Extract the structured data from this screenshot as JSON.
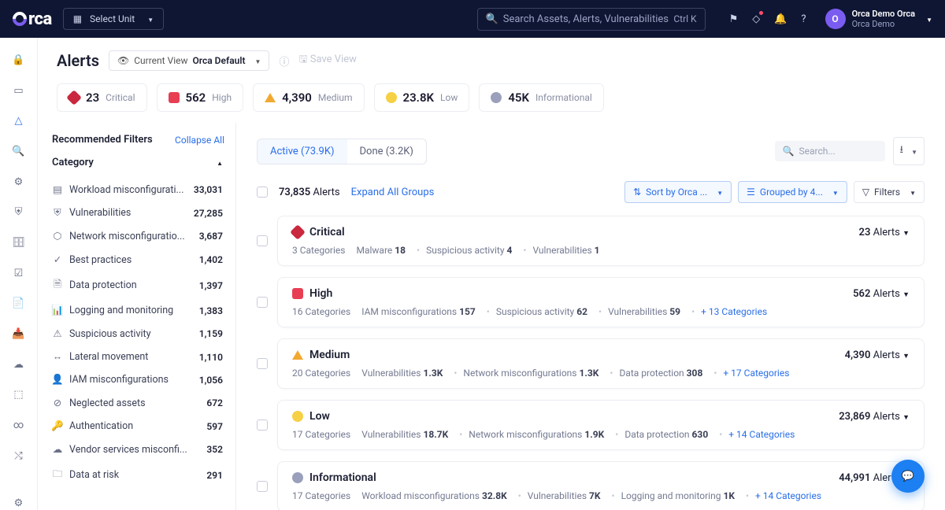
{
  "topbar": {
    "unit_label": "Select Unit",
    "search_placeholder": "Search Assets, Alerts, Vulnerabilities",
    "shortcut": "Ctrl K",
    "user_line1": "Orca Demo Orca",
    "user_line2": "Orca Demo",
    "avatar_letter": "O"
  },
  "page": {
    "title": "Alerts",
    "view_prefix": "Current View",
    "view_name": "Orca Default",
    "save_view": "Save View"
  },
  "severity_summary": [
    {
      "key": "critical",
      "count": "23",
      "label": "Critical"
    },
    {
      "key": "high",
      "count": "562",
      "label": "High"
    },
    {
      "key": "medium",
      "count": "4,390",
      "label": "Medium"
    },
    {
      "key": "low",
      "count": "23.8K",
      "label": "Low"
    },
    {
      "key": "info",
      "count": "45K",
      "label": "Informational"
    }
  ],
  "filters_panel": {
    "title": "Recommended Filters",
    "collapse": "Collapse All",
    "group": "Category",
    "items": [
      {
        "label": "Workload misconfigurati...",
        "count": "33,031"
      },
      {
        "label": "Vulnerabilities",
        "count": "27,285"
      },
      {
        "label": "Network misconfiguratio...",
        "count": "3,687"
      },
      {
        "label": "Best practices",
        "count": "1,402"
      },
      {
        "label": "Data protection",
        "count": "1,397"
      },
      {
        "label": "Logging and monitoring",
        "count": "1,383"
      },
      {
        "label": "Suspicious activity",
        "count": "1,159"
      },
      {
        "label": "Lateral movement",
        "count": "1,110"
      },
      {
        "label": "IAM misconfigurations",
        "count": "1,056"
      },
      {
        "label": "Neglected assets",
        "count": "672"
      },
      {
        "label": "Authentication",
        "count": "597"
      },
      {
        "label": "Vendor services misconfi...",
        "count": "352"
      },
      {
        "label": "Data at risk",
        "count": "291"
      }
    ]
  },
  "tabs": {
    "active": "Active (73.9K)",
    "done": "Done (3.2K)"
  },
  "results": {
    "search_placeholder": "Search...",
    "total_count": "73,835",
    "total_label": "Alerts",
    "expand_all": "Expand All Groups",
    "sort_label": "Sort by Orca ...",
    "group_label": "Grouped by 4...",
    "filters_label": "Filters"
  },
  "groups": [
    {
      "sev": "critical",
      "title": "Critical",
      "categories": "3 Categories",
      "chips": [
        {
          "t": "Malware",
          "n": "18"
        },
        {
          "t": "Suspicious activity",
          "n": "4"
        },
        {
          "t": "Vulnerabilities",
          "n": "1"
        }
      ],
      "more": "",
      "alerts": "23"
    },
    {
      "sev": "high",
      "title": "High",
      "categories": "16 Categories",
      "chips": [
        {
          "t": "IAM misconfigurations",
          "n": "157"
        },
        {
          "t": "Suspicious activity",
          "n": "62"
        },
        {
          "t": "Vulnerabilities",
          "n": "59"
        }
      ],
      "more": "+ 13 Categories",
      "alerts": "562"
    },
    {
      "sev": "medium",
      "title": "Medium",
      "categories": "20 Categories",
      "chips": [
        {
          "t": "Vulnerabilities",
          "n": "1.3K"
        },
        {
          "t": "Network misconfigurations",
          "n": "1.3K"
        },
        {
          "t": "Data protection",
          "n": "308"
        }
      ],
      "more": "+ 17 Categories",
      "alerts": "4,390"
    },
    {
      "sev": "low",
      "title": "Low",
      "categories": "17 Categories",
      "chips": [
        {
          "t": "Vulnerabilities",
          "n": "18.7K"
        },
        {
          "t": "Network misconfigurations",
          "n": "1.9K"
        },
        {
          "t": "Data protection",
          "n": "630"
        }
      ],
      "more": "+ 14 Categories",
      "alerts": "23,869"
    },
    {
      "sev": "info",
      "title": "Informational",
      "categories": "17 Categories",
      "chips": [
        {
          "t": "Workload misconfigurations",
          "n": "32.8K"
        },
        {
          "t": "Vulnerabilities",
          "n": "7K"
        },
        {
          "t": "Logging and monitoring",
          "n": "1K"
        }
      ],
      "more": "+ 14 Categories",
      "alerts": "44,991"
    }
  ],
  "alerts_word": "Alerts"
}
